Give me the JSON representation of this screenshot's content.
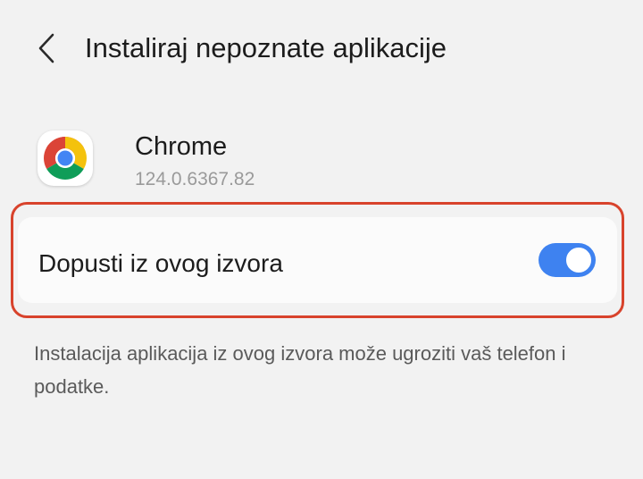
{
  "header": {
    "title": "Instaliraj nepoznate aplikacije",
    "back_icon": "chevron-left-icon"
  },
  "app": {
    "name": "Chrome",
    "version": "124.0.6367.82",
    "icon": "chrome-icon"
  },
  "setting": {
    "label": "Dopusti iz ovog izvora",
    "enabled": true,
    "toggle_color": "#3e82f0",
    "highlight_color": "#d8432c"
  },
  "warning": {
    "text": "Instalacija aplikacija iz ovog izvora može ugroziti vaš telefon i podatke."
  }
}
